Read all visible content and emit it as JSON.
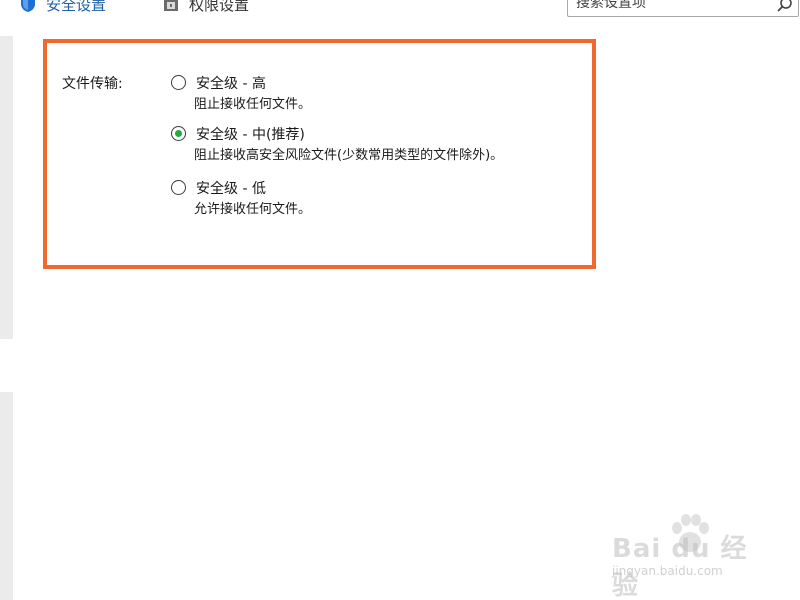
{
  "toolbar": {
    "tabs": [
      {
        "label": "安全设置",
        "icon": "shield-icon",
        "color": "#1f5fa6"
      },
      {
        "label": "权限设置",
        "icon": "lock-icon",
        "color": "#333333"
      }
    ],
    "search": {
      "value": "搜索设置项",
      "icon": "search-icon"
    }
  },
  "file_transfer": {
    "label": "文件传输:",
    "highlight_color": "#f06a2f",
    "options": [
      {
        "title": "安全级 - 高",
        "description": "阻止接收任何文件。",
        "selected": false
      },
      {
        "title": "安全级 - 中(推荐)",
        "description": "阻止接收高安全风险文件(少数常用类型的文件除外)。",
        "selected": true
      },
      {
        "title": "安全级 - 低",
        "description": "允许接收任何文件。",
        "selected": false
      }
    ],
    "selected_color": "#1fae3c"
  },
  "watermark": {
    "brand": "Bai du 经验",
    "sub": "jingyan.baidu.com"
  }
}
